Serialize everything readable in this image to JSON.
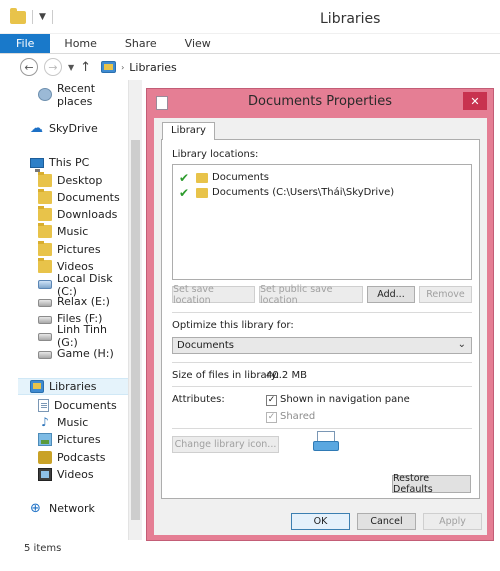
{
  "explorer": {
    "title": "Libraries",
    "tabs": [
      "File",
      "Home",
      "Share",
      "View"
    ],
    "address": "Libraries",
    "status": "5 items"
  },
  "nav": {
    "items": [
      {
        "label": "Recent places",
        "icon": "recent-icon"
      },
      {
        "label": "SkyDrive",
        "icon": "cloud-icon"
      },
      {
        "label": "This PC",
        "icon": "computer-icon"
      },
      {
        "label": "Desktop",
        "icon": "folder-icon"
      },
      {
        "label": "Documents",
        "icon": "folder-icon"
      },
      {
        "label": "Downloads",
        "icon": "folder-icon"
      },
      {
        "label": "Music",
        "icon": "folder-icon"
      },
      {
        "label": "Pictures",
        "icon": "folder-icon"
      },
      {
        "label": "Videos",
        "icon": "folder-icon"
      },
      {
        "label": "Local Disk (C:)",
        "icon": "drive-icon"
      },
      {
        "label": "Relax (E:)",
        "icon": "drive-icon"
      },
      {
        "label": "Files (F:)",
        "icon": "drive-icon"
      },
      {
        "label": "Linh Tinh (G:)",
        "icon": "drive-icon"
      },
      {
        "label": "Game (H:)",
        "icon": "drive-icon"
      },
      {
        "label": "Libraries",
        "icon": "library-icon"
      },
      {
        "label": "Documents",
        "icon": "documents-icon"
      },
      {
        "label": "Music",
        "icon": "music-icon"
      },
      {
        "label": "Pictures",
        "icon": "pictures-icon"
      },
      {
        "label": "Podcasts",
        "icon": "podcast-icon"
      },
      {
        "label": "Videos",
        "icon": "video-icon"
      },
      {
        "label": "Network",
        "icon": "network-icon"
      }
    ]
  },
  "dialog": {
    "title": "Documents Properties",
    "close": "✕",
    "tab": "Library",
    "locations_label": "Library locations:",
    "locations": [
      "Documents",
      "Documents (C:\\Users\\Thái\\SkyDrive)"
    ],
    "buttons": {
      "set_save": "Set save location",
      "set_public": "Set public save location",
      "add": "Add...",
      "remove": "Remove"
    },
    "optimize_label": "Optimize this library for:",
    "optimize_value": "Documents",
    "size_label": "Size of files in library:",
    "size_value": "40.2 MB",
    "attributes_label": "Attributes:",
    "attr_nav": "Shown in navigation pane",
    "attr_shared": "Shared",
    "change_icon": "Change library icon...",
    "restore": "Restore Defaults",
    "ok": "OK",
    "cancel": "Cancel",
    "apply": "Apply"
  },
  "colors": {
    "dialog_frame": "#e57e94",
    "close_button": "#c8324f",
    "file_tab": "#1979ca"
  }
}
